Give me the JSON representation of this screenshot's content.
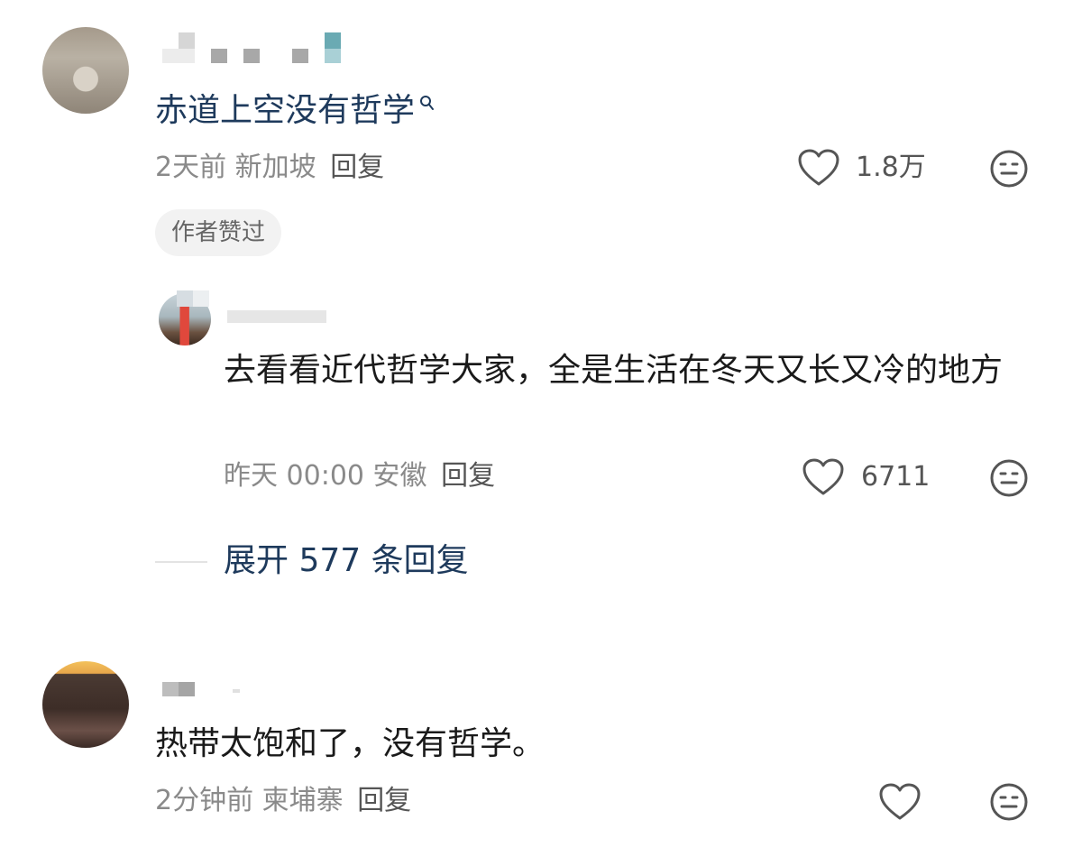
{
  "comments": [
    {
      "text": "赤道上空没有哲学",
      "text_has_search_icon": true,
      "time": "2天前",
      "location": "新加坡",
      "reply_label": "回复",
      "likes": "1.8万",
      "tag": "作者赞过"
    },
    {
      "text": "去看看近代哲学大家，全是生活在冬天又长又冷的地方",
      "time": "昨天 00:00",
      "location": "安徽",
      "reply_label": "回复",
      "likes": "6711"
    },
    {
      "text": "热带太饱和了，没有哲学。",
      "time": "2分钟前",
      "location": "柬埔寨",
      "reply_label": "回复",
      "likes": ""
    }
  ],
  "expand_replies": "展开 577 条回复",
  "colors": {
    "link": "#1e3a5c",
    "meta": "#8a8a8a",
    "icon": "#555555"
  },
  "icons": [
    "heart-icon",
    "dislike-face-icon",
    "search-icon"
  ]
}
